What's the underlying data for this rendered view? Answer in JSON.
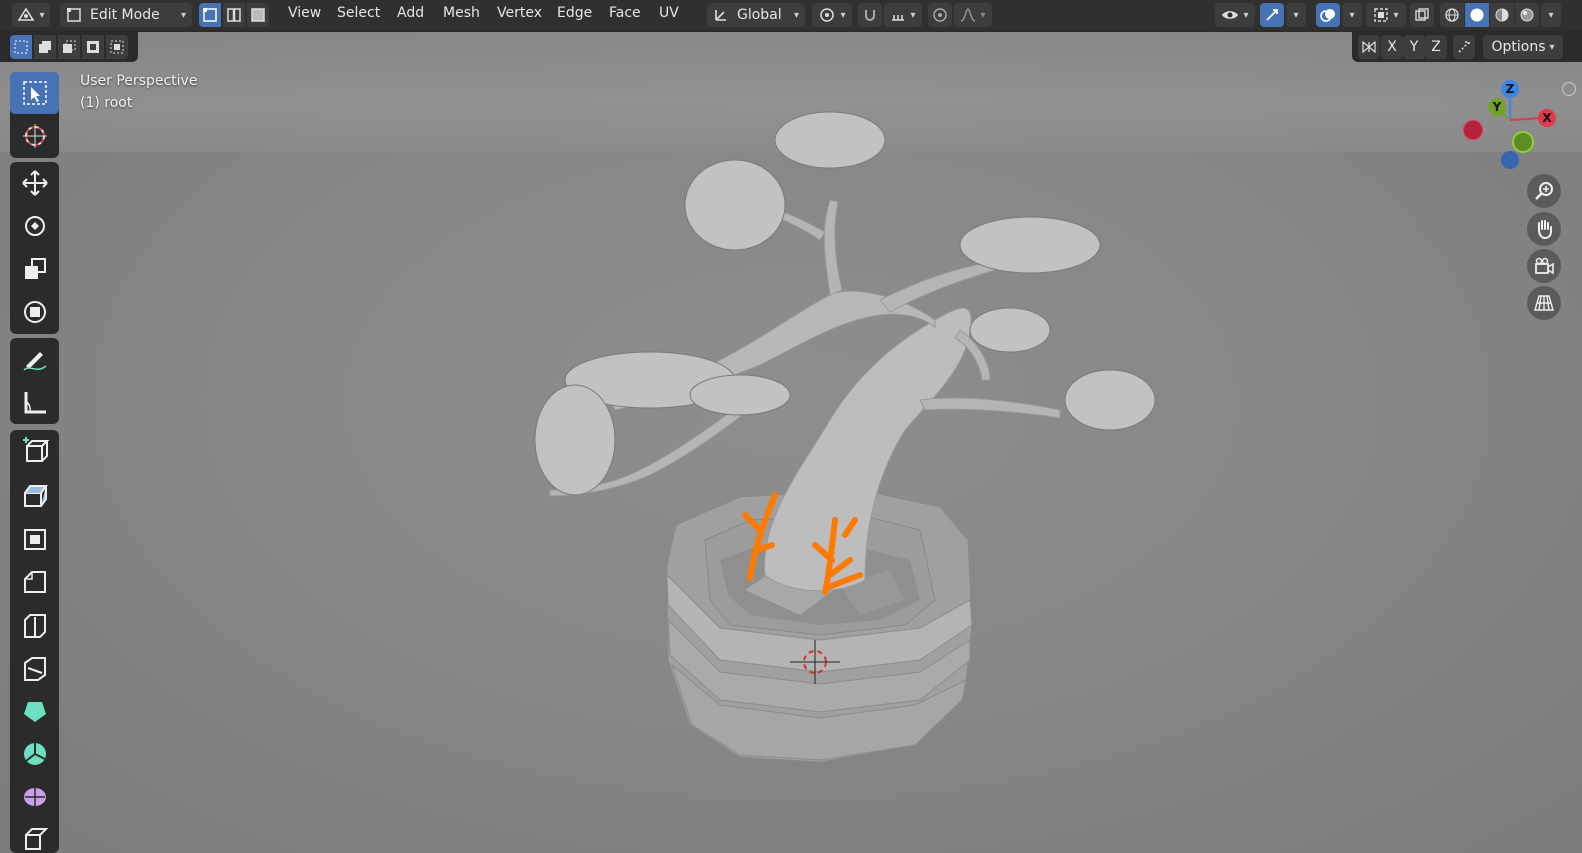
{
  "header": {
    "mode_label": "Edit Mode",
    "menus": [
      "View",
      "Select",
      "Add",
      "Mesh",
      "Vertex",
      "Edge",
      "Face",
      "UV"
    ],
    "transform_orientation": "Global",
    "options_label": "Options",
    "axis_x": "X",
    "axis_y": "Y",
    "axis_z": "Z"
  },
  "viewport": {
    "view_name": "User Perspective",
    "object_name": "(1) root"
  },
  "gizmo": {
    "z_label": "Z",
    "y_label": "Y",
    "x_label": "X"
  },
  "colors": {
    "accent": "#4772b3",
    "selection": "#ff7a00",
    "axis_x": "#e0384f",
    "axis_y": "#6fa32a",
    "axis_z": "#3a86e6",
    "header_bg": "#303030",
    "viewport_bg": "#858585"
  },
  "icons": {
    "editor_type": "mesh-editor-icon",
    "vertex_select": "vertex-select-icon",
    "edge_select": "edge-select-icon",
    "face_select": "face-select-icon"
  }
}
